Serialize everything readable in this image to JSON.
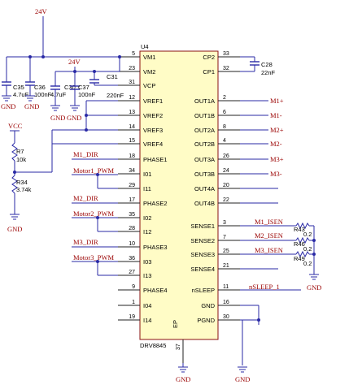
{
  "schematic": {
    "ic": {
      "ref": "U4",
      "part": "DRV8845",
      "exposed_pad": "EP",
      "left_pins": [
        {
          "num": "5",
          "name": "VM1"
        },
        {
          "num": "23",
          "name": "VM2"
        },
        {
          "num": "31",
          "name": "VCP"
        },
        {
          "num": "12",
          "name": "VREF1"
        },
        {
          "num": "13",
          "name": "VREF2"
        },
        {
          "num": "14",
          "name": "VREF3"
        },
        {
          "num": "15",
          "name": "VREF4"
        },
        {
          "num": "18",
          "name": "PHASE1"
        },
        {
          "num": "34",
          "name": "I01"
        },
        {
          "num": "29",
          "name": "I11"
        },
        {
          "num": "17",
          "name": "PHASE2"
        },
        {
          "num": "35",
          "name": "I02"
        },
        {
          "num": "28",
          "name": "I12"
        },
        {
          "num": "10",
          "name": "PHASE3"
        },
        {
          "num": "36",
          "name": "I03"
        },
        {
          "num": "27",
          "name": "I13"
        },
        {
          "num": "9",
          "name": "PHASE4"
        },
        {
          "num": "1",
          "name": "I04"
        },
        {
          "num": "19",
          "name": "I14"
        }
      ],
      "right_pins": [
        {
          "num": "33",
          "name": "CP2"
        },
        {
          "num": "32",
          "name": "CP1"
        },
        {
          "num": "2",
          "name": "OUT1A"
        },
        {
          "num": "6",
          "name": "OUT1B"
        },
        {
          "num": "8",
          "name": "OUT2A"
        },
        {
          "num": "4",
          "name": "OUT2B"
        },
        {
          "num": "26",
          "name": "OUT3A"
        },
        {
          "num": "24",
          "name": "OUT3B"
        },
        {
          "num": "20",
          "name": "OUT4A"
        },
        {
          "num": "22",
          "name": "OUT4B"
        },
        {
          "num": "3",
          "name": "SENSE1"
        },
        {
          "num": "7",
          "name": "SENSE2"
        },
        {
          "num": "25",
          "name": "SENSE3"
        },
        {
          "num": "21",
          "name": "SENSE4"
        },
        {
          "num": "11",
          "name": "nSLEEP"
        },
        {
          "num": "16",
          "name": "GND"
        },
        {
          "num": "30",
          "name": "PGND"
        }
      ],
      "bottom_pin": {
        "num": "37"
      }
    },
    "power_labels": {
      "vm_top": "24V",
      "vm_mid": "24V",
      "vcc": "VCC"
    },
    "gnd_label": "GND",
    "caps": [
      {
        "ref": "C35",
        "value": "4.7uF"
      },
      {
        "ref": "C36",
        "value": "100nF"
      },
      {
        "ref": "C30",
        "value": "4.7uF"
      },
      {
        "ref": "C37",
        "value": "100nF"
      },
      {
        "ref": "C31",
        "value": "220nF"
      },
      {
        "ref": "C28",
        "value": "22nF"
      }
    ],
    "resistors": [
      {
        "ref": "R7",
        "value": "10k"
      },
      {
        "ref": "R34",
        "value": "3.74k"
      },
      {
        "ref": "R43",
        "value": "0.2"
      },
      {
        "ref": "R46",
        "value": "0.2"
      },
      {
        "ref": "R49",
        "value": "0.2"
      }
    ],
    "nets": {
      "m1_dir": "M1_DIR",
      "motor1_pwm": "Motor1_PWM",
      "m2_dir": "M2_DIR",
      "motor2_pwm": "Motor2_PWM",
      "m3_dir": "M3_DIR",
      "motor3_pwm": "Motor3_PWM",
      "m1_plus": "M1+",
      "m1_minus": "M1-",
      "m2_plus": "M2+",
      "m2_minus": "M2-",
      "m3_plus": "M3+",
      "m3_minus": "M3-",
      "m1_isen": "M1_ISEN",
      "m2_isen": "M2_ISEN",
      "m3_isen": "M3_ISEN",
      "nsleep": "nSLEEP_1"
    }
  }
}
